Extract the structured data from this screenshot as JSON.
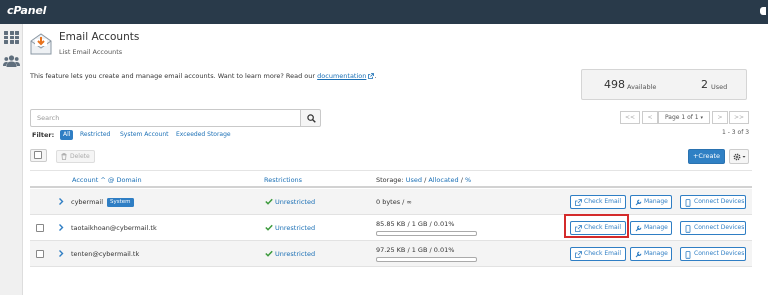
{
  "header": {
    "logo_text": "cPanel",
    "background": "#293a4a"
  },
  "sidebar": {
    "items": [
      {
        "icon": "grid-icon"
      },
      {
        "icon": "users-icon"
      }
    ]
  },
  "page": {
    "title": "Email Accounts",
    "subtitle": "List Email Accounts",
    "icon": "envelope-download-icon"
  },
  "intro": {
    "text": "This feature lets you create and manage email accounts. Want to learn more? Read our ",
    "link": "documentation",
    "suffix": "."
  },
  "stats": {
    "available_count": "498",
    "available_label": "Available",
    "used_count": "2",
    "used_label": "Used"
  },
  "search": {
    "placeholder": "Search"
  },
  "pagination": {
    "first": "<<",
    "prev": "<",
    "page_label": "Page 1 of 1",
    "next": ">",
    "last": ">>",
    "range": "1 - 3 of 3"
  },
  "filters": {
    "label": "Filter:",
    "items": [
      "All",
      "Restricted",
      "System Account",
      "Exceeded Storage"
    ],
    "active": "All"
  },
  "toolbar": {
    "delete_label": "Delete",
    "create_label": "Create"
  },
  "table": {
    "headers": {
      "account": "Account",
      "at": "@",
      "domain": "Domain",
      "restrictions": "Restrictions",
      "storage": "Storage:",
      "used": "Used",
      "allocated": "Allocated",
      "percent": "%",
      "slash": "/"
    },
    "rows": [
      {
        "account": "cybermail",
        "badge": "System",
        "restrictions": "Unrestricted",
        "storage": "0 bytes / ∞",
        "usage_fraction": 0,
        "selectable": false
      },
      {
        "account": "taotaikhoan@cybermail.tk",
        "restrictions": "Unrestricted",
        "storage": "85.85 KB / 1 GB / 0.01%",
        "usage_fraction": 0.0001,
        "selectable": true
      },
      {
        "account": "tenten@cybermail.tk",
        "restrictions": "Unrestricted",
        "storage": "97.25 KB / 1 GB / 0.01%",
        "usage_fraction": 0.0001,
        "selectable": true
      }
    ],
    "actions": {
      "check_email": "Check Email",
      "manage": "Manage",
      "connect_devices": "Connect Devices"
    }
  },
  "colors": {
    "accent": "#2f7ec4",
    "highlight": "#d42b2b",
    "success": "#3c9a3c"
  }
}
